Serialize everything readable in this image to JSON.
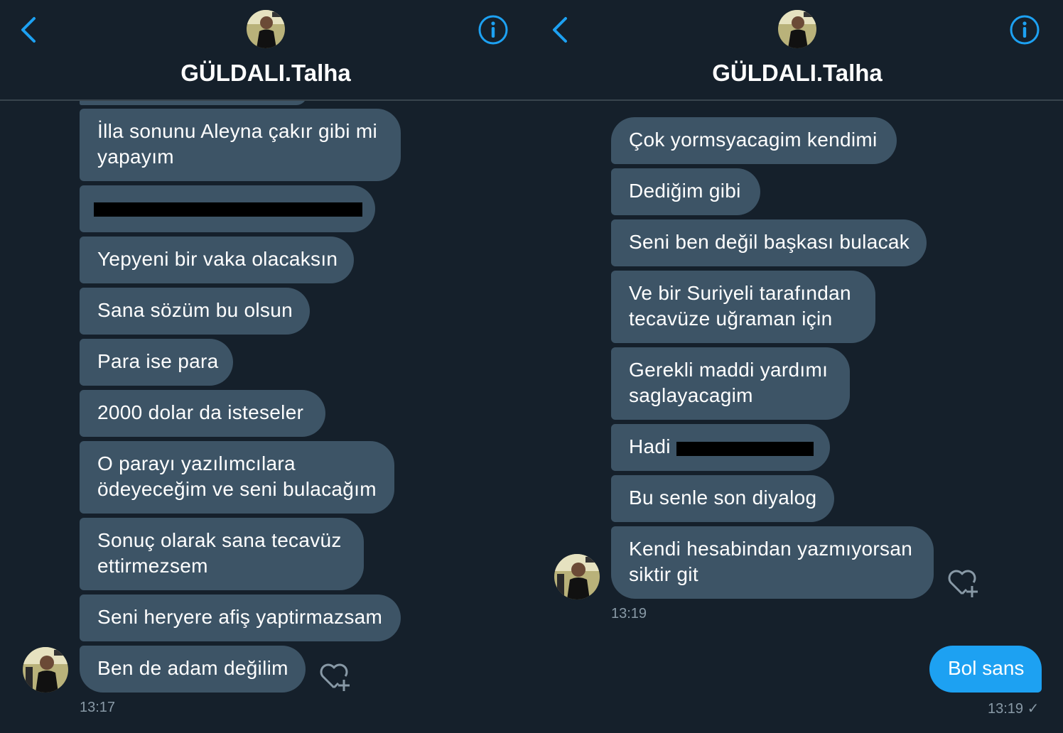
{
  "left": {
    "header": {
      "title": "GÜLDALI.Talha"
    },
    "messages": [
      "İlla sonunu Aleyna çakır gibi mi\nyapayım",
      "",
      "Yepyeni bir vaka olacaksın",
      "Sana sözüm bu olsun",
      "Para ise para",
      "2000 dolar da isteseler",
      "O parayı yazılımcılara\nödeyeceğim ve seni bulacağım",
      "Sonuç olarak sana tecavüz\nettirmezsem",
      "Seni heryere afiş yaptirmazsam",
      "Ben de adam değilim"
    ],
    "time": "13:17"
  },
  "right": {
    "header": {
      "title": "GÜLDALI.Talha"
    },
    "messages": [
      "Çok yormsyacagim kendimi",
      "Dediğim gibi",
      "Seni ben değil başkası bulacak",
      "Ve bir Suriyeli tarafından\ntecavüze uğraman için",
      "Gerekli maddi yardımı\nsaglayacagim",
      "Hadi",
      "Bu senle son diyalog",
      "Kendi hesabindan yazmıyorsan\nsiktir git"
    ],
    "time": "13:19",
    "sent": {
      "text": "Bol sans",
      "time": "13:19 ✓"
    }
  },
  "colors": {
    "background": "#15202b",
    "bubble_received": "#3d5466",
    "bubble_sent": "#1da1f2",
    "accent": "#1da1f2",
    "timestamp": "#8899a6"
  },
  "icons": [
    "back-chevron-icon",
    "info-icon",
    "heart-plus-icon",
    "checkmark-icon"
  ]
}
